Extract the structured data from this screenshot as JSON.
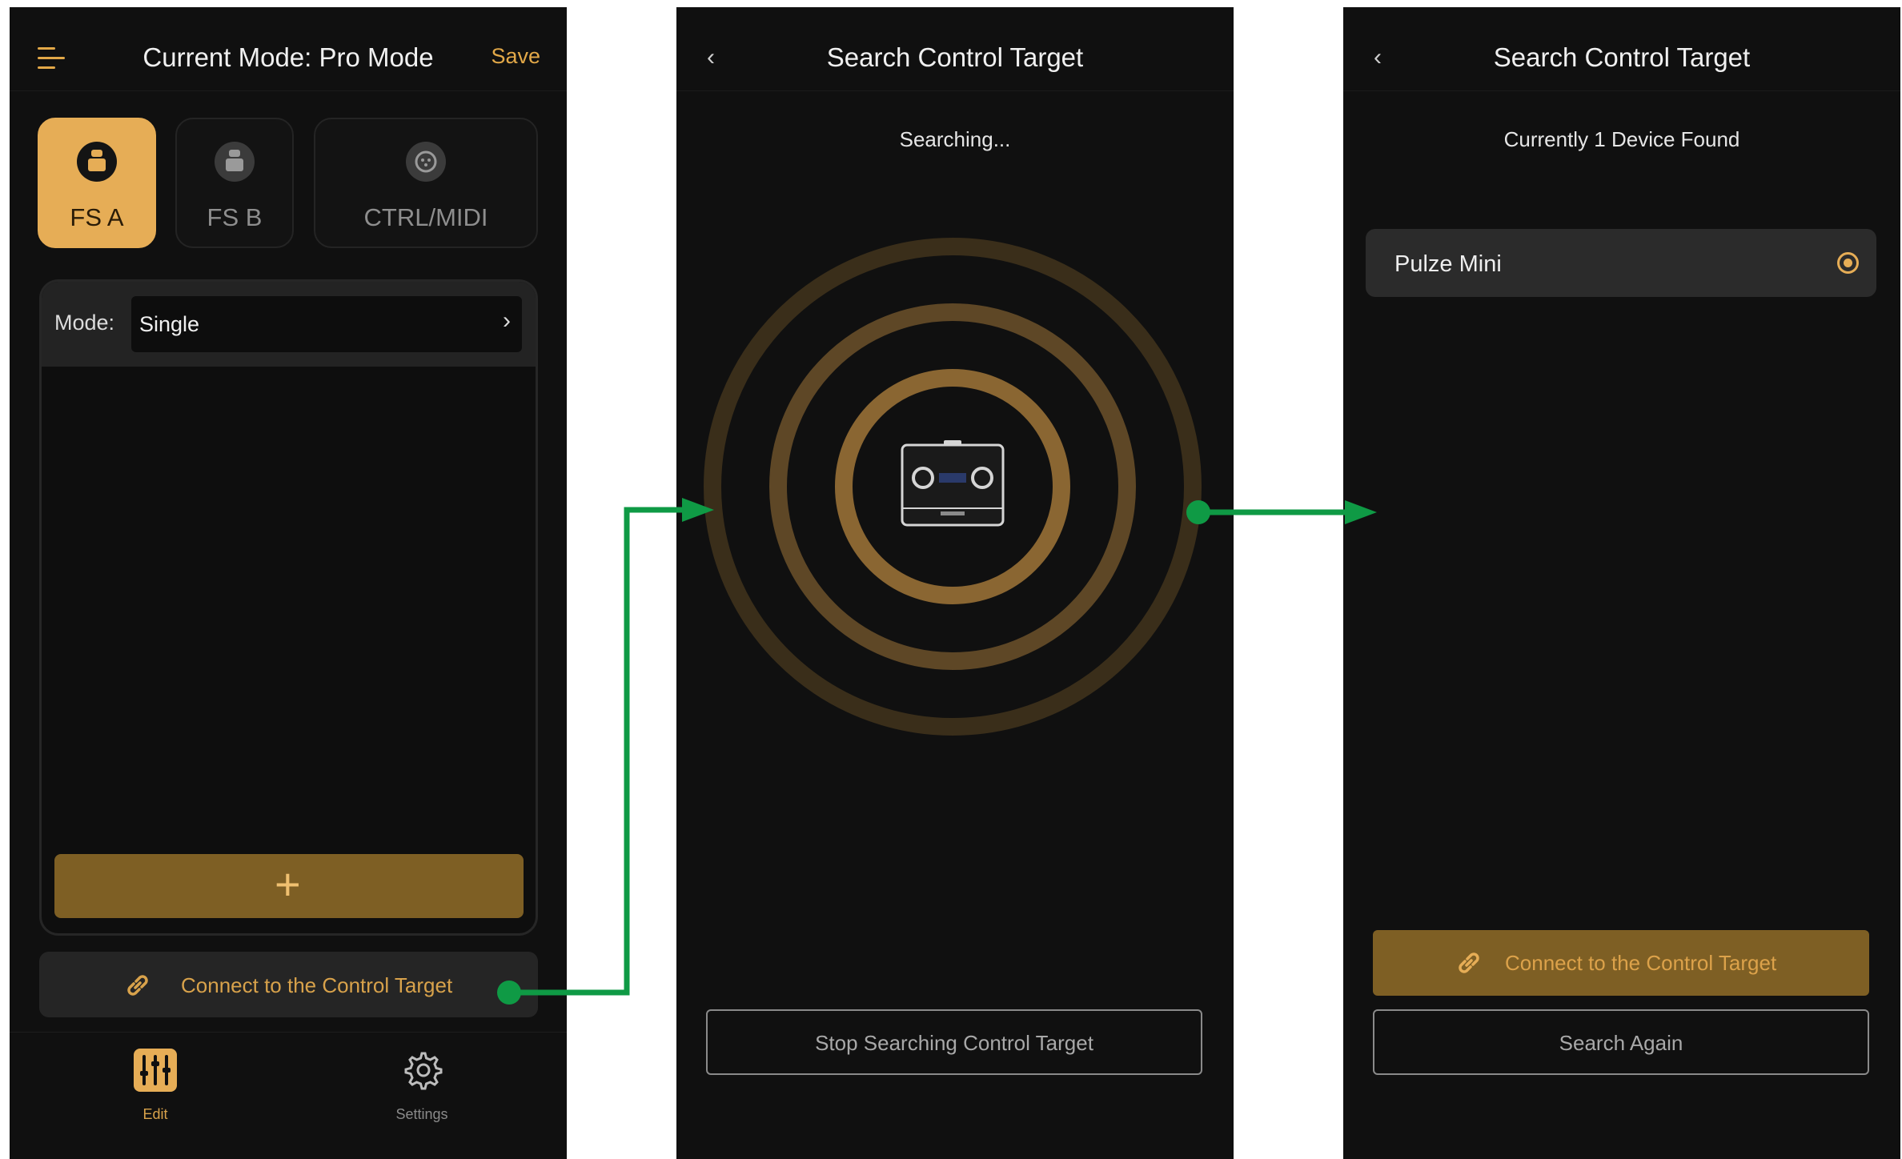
{
  "screen1": {
    "title": "Current Mode: Pro Mode",
    "save_label": "Save",
    "tabs": [
      {
        "label": "FS A",
        "icon": "footswitch-icon",
        "active": true
      },
      {
        "label": "FS B",
        "icon": "footswitch-icon",
        "active": false
      },
      {
        "label": "CTRL/MIDI",
        "icon": "midi-icon",
        "active": false
      }
    ],
    "mode_label": "Mode:",
    "mode_value": "Single",
    "add_label": "+",
    "connect_label": "Connect to the Control Target",
    "nav": [
      {
        "label": "Edit",
        "icon": "sliders-icon",
        "active": true
      },
      {
        "label": "Settings",
        "icon": "gear-icon",
        "active": false
      }
    ]
  },
  "screen2": {
    "title": "Search Control Target",
    "status": "Searching...",
    "stop_label": "Stop Searching Control Target"
  },
  "screen3": {
    "title": "Search Control Target",
    "status": "Currently 1 Device Found",
    "devices": [
      {
        "name": "Pulze Mini",
        "selected": true
      }
    ],
    "connect_label": "Connect to the Control Target",
    "search_again_label": "Search Again"
  },
  "colors": {
    "accent": "#e6ad56",
    "accent_dark": "#7e5f24",
    "background": "#101010",
    "flow_arrow": "#0f9a45"
  }
}
